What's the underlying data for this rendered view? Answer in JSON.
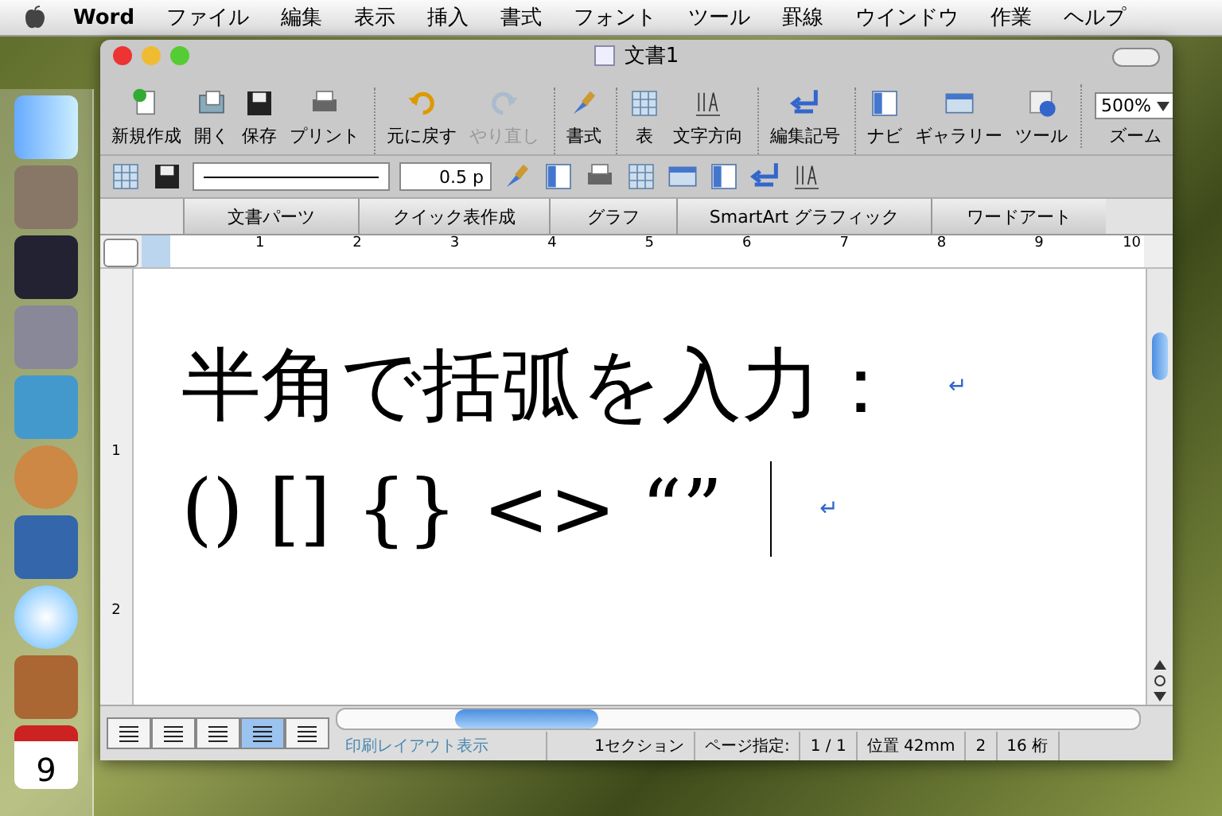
{
  "menubar": {
    "app": "Word",
    "items": [
      "ファイル",
      "編集",
      "表示",
      "挿入",
      "書式",
      "フォント",
      "ツール",
      "罫線",
      "ウインドウ",
      "作業",
      "ヘルプ"
    ]
  },
  "dock": {
    "calendar_day": "9"
  },
  "window": {
    "title": "文書1"
  },
  "toolbar": [
    {
      "label": "新規作成",
      "disabled": false,
      "group_start": false
    },
    {
      "label": "開く",
      "disabled": false,
      "group_start": false
    },
    {
      "label": "保存",
      "disabled": false,
      "group_start": false
    },
    {
      "label": "プリント",
      "disabled": false,
      "group_start": false
    },
    {
      "label": "元に戻す",
      "disabled": false,
      "group_start": true
    },
    {
      "label": "やり直し",
      "disabled": true,
      "group_start": false
    },
    {
      "label": "書式",
      "disabled": false,
      "group_start": true
    },
    {
      "label": "表",
      "disabled": false,
      "group_start": true
    },
    {
      "label": "文字方向",
      "disabled": false,
      "group_start": false
    },
    {
      "label": "編集記号",
      "disabled": false,
      "group_start": true
    },
    {
      "label": "ナビ",
      "disabled": false,
      "group_start": true
    },
    {
      "label": "ギャラリー",
      "disabled": false,
      "group_start": false
    },
    {
      "label": "ツール",
      "disabled": false,
      "group_start": false
    }
  ],
  "zoom": {
    "value": "500%",
    "label": "ズーム"
  },
  "format_toolbar": {
    "line_weight": "0.5 p"
  },
  "gallery_tabs": [
    "文書パーツ",
    "クイック表作成",
    "グラフ",
    "SmartArt グラフィック",
    "ワードアート"
  ],
  "ruler": {
    "ticks": [
      "1",
      "2",
      "3",
      "4",
      "5",
      "6",
      "7",
      "8",
      "9",
      "10"
    ],
    "vertical_ticks": [
      "1",
      "2"
    ]
  },
  "document": {
    "lines": [
      "半角で括弧を入力：",
      "() [] {} <> “”"
    ],
    "para_mark": "↵"
  },
  "view_buttons": [
    {
      "selected": false
    },
    {
      "selected": false
    },
    {
      "selected": false
    },
    {
      "selected": true
    },
    {
      "selected": false
    }
  ],
  "status_bar": {
    "view": "印刷レイアウト表示",
    "section": "1セクション",
    "page_label": "ページ指定:",
    "page": "1 / 1",
    "position": "位置 42mm",
    "line": "2",
    "column": "16 桁"
  }
}
